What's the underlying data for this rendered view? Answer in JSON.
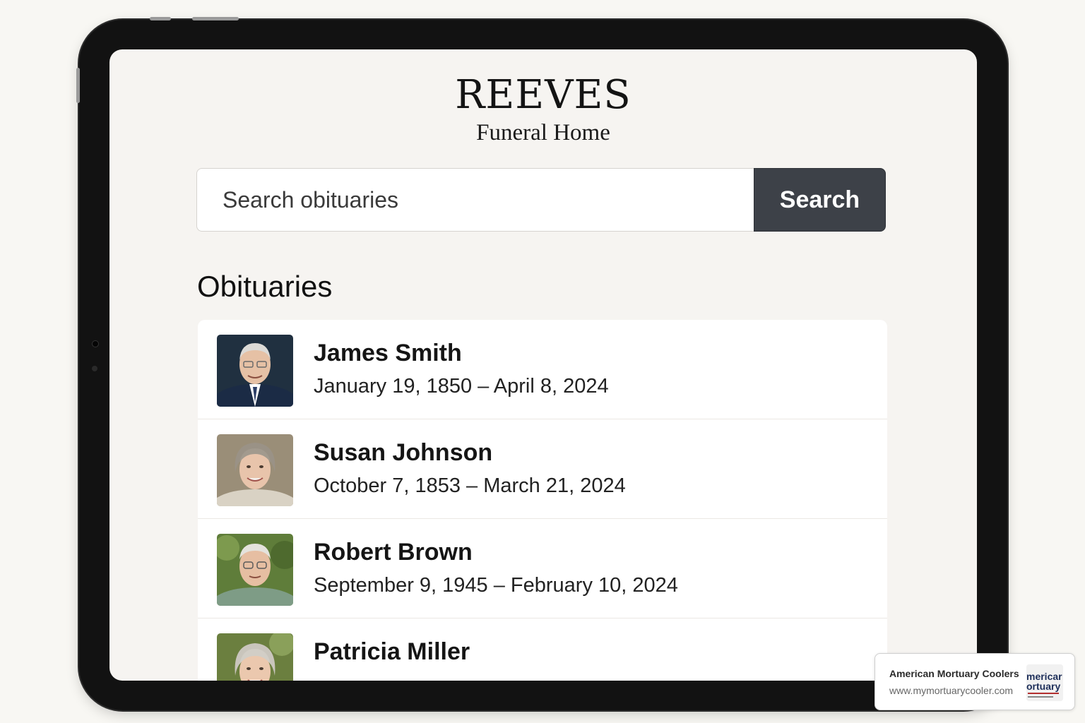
{
  "brand": {
    "name": "REEVES",
    "subtitle": "Funeral Home"
  },
  "search": {
    "placeholder": "Search obituaries",
    "button_label": "Search"
  },
  "section": {
    "title": "Obituaries"
  },
  "obituaries": [
    {
      "name": "James Smith",
      "dates": "January 19, 1850 – April 8, 2024",
      "photo_bg": "#203040",
      "hair": "#d8d6d2",
      "shirt": "#1b2b45"
    },
    {
      "name": "Susan Johnson",
      "dates": "October 7, 1853 – March 21, 2024",
      "photo_bg": "#9a8e78",
      "hair": "#9a9286",
      "shirt": "#d9d2c4"
    },
    {
      "name": "Robert Brown",
      "dates": "September 9, 1945 – February 10, 2024",
      "photo_bg": "#5f7d3a",
      "hair": "#e4e2dc",
      "shirt": "#7e9c86"
    },
    {
      "name": "Patricia Miller",
      "dates": "",
      "photo_bg": "#6b7f3f",
      "hair": "#c9c5bc",
      "shirt": "#c9c2b4"
    }
  ],
  "watermark": {
    "name": "American Mortuary Coolers",
    "url": "www.mymortuarycooler.com",
    "logo_text": "mericar ortuary"
  },
  "colors": {
    "accent_button": "#3d4148",
    "page_bg": "#f6f4f1",
    "frame": "#121212"
  }
}
